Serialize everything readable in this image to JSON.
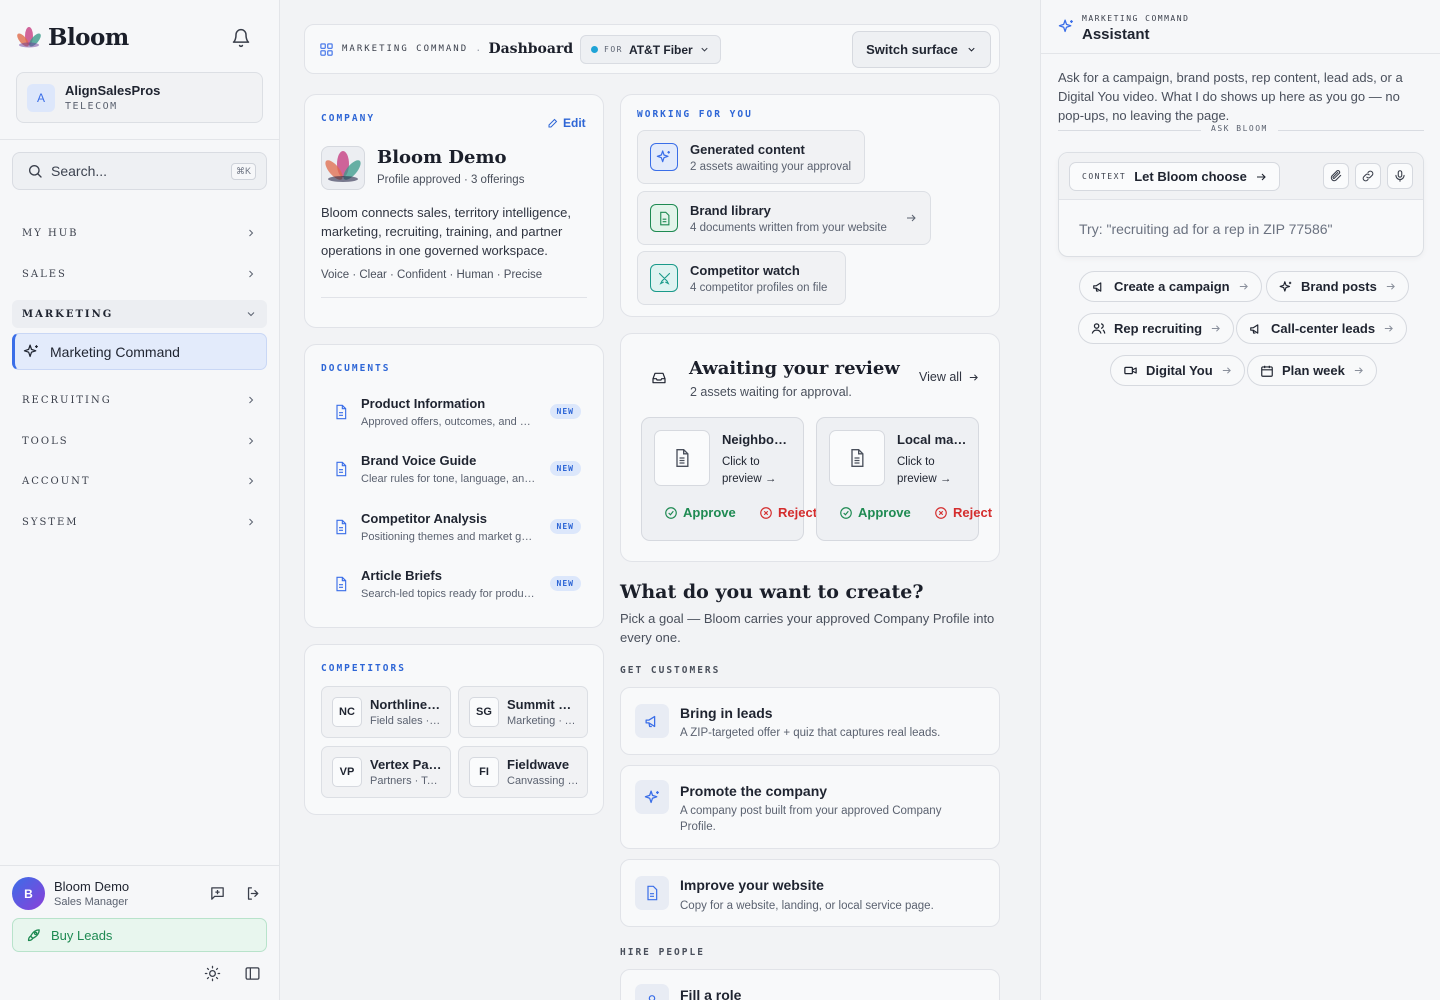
{
  "sidebar": {
    "brand": "Bloom",
    "org": {
      "initial": "A",
      "name": "AlignSalesPros",
      "segment": "TELECOM"
    },
    "search": {
      "placeholder": "Search...",
      "shortcut": "⌘K"
    },
    "nav": [
      "MY HUB",
      "SALES",
      "MARKETING",
      "RECRUITING",
      "TOOLS",
      "ACCOUNT",
      "SYSTEM"
    ],
    "active_item": "Marketing Command",
    "user": {
      "initial": "B",
      "name": "Bloom Demo",
      "role": "Sales Manager"
    },
    "buy_leads": "Buy Leads"
  },
  "topbar": {
    "section": "MARKETING COMMAND",
    "separator": "·",
    "page": "Dashboard",
    "for_label": "FOR",
    "for_value": "AT&T Fiber",
    "switch_label": "Switch surface"
  },
  "company": {
    "label": "COMPANY",
    "edit": "Edit",
    "name": "Bloom Demo",
    "meta": "Profile approved · 3 offerings",
    "description": "Bloom connects sales, territory intelligence, marketing, recruiting, training, and partner operations in one governed workspace.",
    "voice": "Voice · Clear · Confident · Human · Precise"
  },
  "documents": {
    "label": "DOCUMENTS",
    "badge": "NEW",
    "items": [
      {
        "title": "Product Information",
        "desc": "Approved offers, outcomes, and proof points"
      },
      {
        "title": "Brand Voice Guide",
        "desc": "Clear rules for tone, language, and style"
      },
      {
        "title": "Competitor Analysis",
        "desc": "Positioning themes and market gaps"
      },
      {
        "title": "Article Briefs",
        "desc": "Search-led topics ready for production"
      }
    ]
  },
  "competitors": {
    "label": "COMPETITORS",
    "items": [
      {
        "abbr": "NC",
        "name": "Northline Communications",
        "desc": "Field sales · Telecom"
      },
      {
        "abbr": "SG",
        "name": "Summit Group",
        "desc": "Marketing · Agency"
      },
      {
        "abbr": "VP",
        "name": "Vertex Partners",
        "desc": "Partners · Telecom"
      },
      {
        "abbr": "FI",
        "name": "Fieldwave",
        "desc": "Canvassing · Door-to-door"
      }
    ]
  },
  "working": {
    "label": "WORKING FOR YOU",
    "items": [
      {
        "title": "Generated content",
        "desc": "2 assets awaiting your approval"
      },
      {
        "title": "Brand library",
        "desc": "4 documents written from your website"
      },
      {
        "title": "Competitor watch",
        "desc": "4 competitor profiles on file"
      }
    ]
  },
  "review": {
    "title": "Awaiting your review",
    "subtitle": "2 assets waiting for approval.",
    "view_all": "View all",
    "approve": "Approve",
    "reject": "Reject",
    "preview": "Click to preview →",
    "assets": [
      {
        "title": "Neighborhood"
      },
      {
        "title": "Local market"
      }
    ]
  },
  "create": {
    "title": "What do you want to create?",
    "subtitle": "Pick a goal — Bloom carries your approved Company Profile into every one.",
    "group1": "GET CUSTOMERS",
    "group2": "HIRE PEOPLE",
    "actions": [
      {
        "title": "Bring in leads",
        "desc": "A ZIP-targeted offer + quiz that captures real leads."
      },
      {
        "title": "Promote the company",
        "desc": "A company post built from your approved Company Profile."
      },
      {
        "title": "Improve your website",
        "desc": "Copy for a website, landing, or local service page."
      },
      {
        "title": "Fill a role",
        "desc": ""
      }
    ]
  },
  "assistant": {
    "section": "MARKETING COMMAND",
    "title": "Assistant",
    "intro": "Ask for a campaign, brand posts, rep content, lead ads, or a Digital You video. What I do shows up here as you go — no pop-ups, no leaving the page.",
    "ask_label": "ASK BLOOM",
    "context_label": "CONTEXT",
    "context_value": "Let Bloom choose",
    "input_placeholder": "Try: \"recruiting ad for a rep in ZIP 77586\"",
    "chips": [
      "Create a campaign",
      "Brand posts",
      "Rep recruiting",
      "Call-center leads",
      "Digital You",
      "Plan week"
    ]
  },
  "colors": {
    "accent": "#3a6ee8",
    "success": "#1e8a52",
    "danger": "#d42d2d",
    "info": "#2e66d6"
  }
}
